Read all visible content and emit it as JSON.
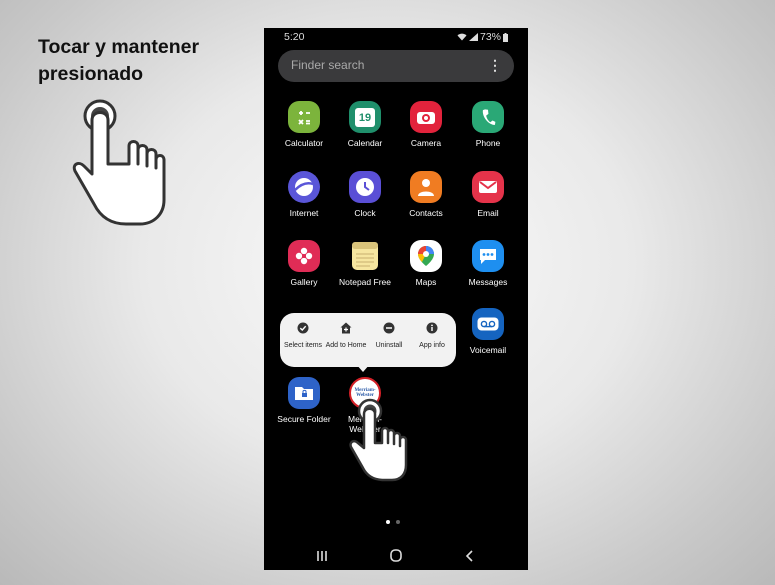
{
  "slide": {
    "instruction": "Tocar y mantener presionado"
  },
  "status_bar": {
    "time": "5:20",
    "battery": "73%"
  },
  "finder": {
    "placeholder": "Finder search"
  },
  "apps": {
    "calculator": "Calculator",
    "calendar": "Calendar",
    "calendar_day": "19",
    "camera": "Camera",
    "phone": "Phone",
    "internet": "Internet",
    "clock": "Clock",
    "contacts": "Contacts",
    "email": "Email",
    "gallery": "Gallery",
    "notepad": "Notepad Free",
    "maps": "Maps",
    "messages": "Messages",
    "voicemail": "Voicemail",
    "secure_folder": "Secure Folder",
    "merriam_webster": "Merriam-Webster",
    "merriam_webster_logo": "Merriam-Webster"
  },
  "context_menu": {
    "select_items": "Select items",
    "add_to_home": "Add to Home",
    "uninstall": "Uninstall",
    "app_info": "App info"
  },
  "page_indicator": {
    "pages": 2,
    "current": 1
  },
  "colors": {
    "calculator": "#7cb43c",
    "calendar": "#1f8f6b",
    "camera": "#e2233c",
    "phone": "#2aa876",
    "internet": "#5a56d8",
    "clock": "#5a4fd6",
    "contacts": "#f07c22",
    "email": "#e5334a",
    "gallery": "#e02c56",
    "maps": "#ffffff",
    "messages": "#1e8ff0",
    "voicemail": "#1564c0",
    "secure_folder": "#2e63c8",
    "context_menu": "#f2f2f2"
  },
  "icons": {
    "hand": "pointing-hand-icon",
    "wifi": "wifi-icon",
    "signal": "signal-icon",
    "battery": "battery-icon",
    "more": "more-vertical-icon",
    "recents": "recents-icon",
    "home": "home-icon",
    "back": "back-icon"
  }
}
